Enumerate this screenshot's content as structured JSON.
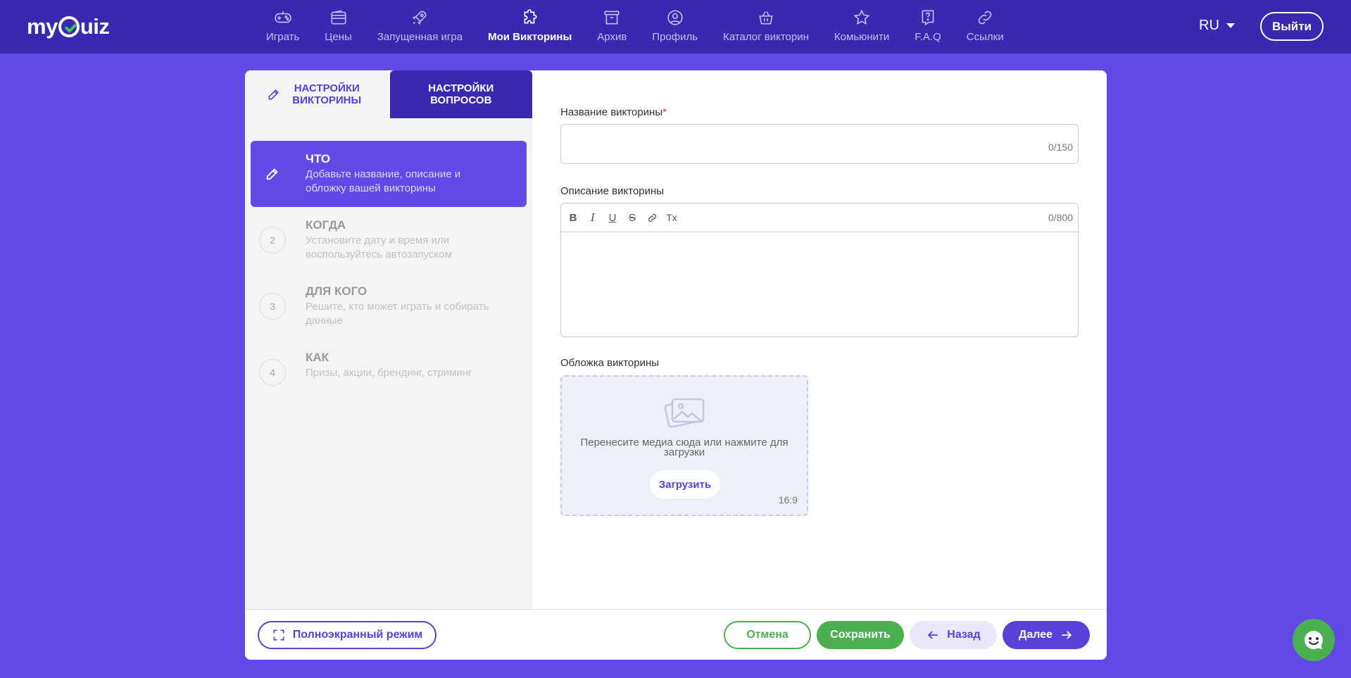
{
  "brand": {
    "logo_left": "my",
    "logo_right": "uiz"
  },
  "nav": [
    {
      "label": "Играть",
      "icon": "gamepad-icon"
    },
    {
      "label": "Цены",
      "icon": "wallet-icon"
    },
    {
      "label": "Запущенная игра",
      "icon": "rocket-icon"
    },
    {
      "label": "Мои Викторины",
      "icon": "puzzle-icon",
      "active": true
    },
    {
      "label": "Архив",
      "icon": "archive-icon"
    },
    {
      "label": "Профиль",
      "icon": "user-circle-icon"
    },
    {
      "label": "Каталог викторин",
      "icon": "basket-icon"
    },
    {
      "label": "Комьюнити",
      "icon": "star-icon"
    },
    {
      "label": "F.A.Q",
      "icon": "question-icon"
    },
    {
      "label": "Ссылки",
      "icon": "link-icon"
    }
  ],
  "header": {
    "language": "RU",
    "logout": "Выйти"
  },
  "tabs": {
    "quiz_settings": "Настройки викторины",
    "question_settings": "Настройки вопросов"
  },
  "steps": [
    {
      "number": "",
      "title": "Что",
      "desc": "Добавьте название, описание и обложку вашей викторины"
    },
    {
      "number": "2",
      "title": "Когда",
      "desc": "Установите дату и время или воспользуйтесь автозапуском"
    },
    {
      "number": "3",
      "title": "Для кого",
      "desc": "Решите, кто может играть и собирать данные"
    },
    {
      "number": "4",
      "title": "Как",
      "desc": "Призы, акции, брендинг, стриминг"
    }
  ],
  "form": {
    "name_label": "Название викторины",
    "name_required": "*",
    "name_value": "",
    "name_counter": "0/150",
    "desc_label": "Описание викторины",
    "desc_counter": "0/800",
    "toolbar": {
      "bold": "B",
      "italic": "I",
      "underline": "U",
      "strike": "S",
      "clear": "Tx"
    },
    "cover_label": "Обложка викторины",
    "cover_text": "Перенесите медиа сюда или нажмите для загрузки",
    "cover_button": "Загрузить",
    "cover_ratio": "16:9"
  },
  "footer": {
    "fullscreen": "Полноэкранный режим",
    "cancel": "Отмена",
    "save": "Сохранить",
    "back": "Назад",
    "next": "Далее"
  },
  "colors": {
    "nav_bg": "#3a28b1",
    "page_bg": "#6249e8",
    "accent": "#5741d9",
    "success": "#4caf50"
  }
}
